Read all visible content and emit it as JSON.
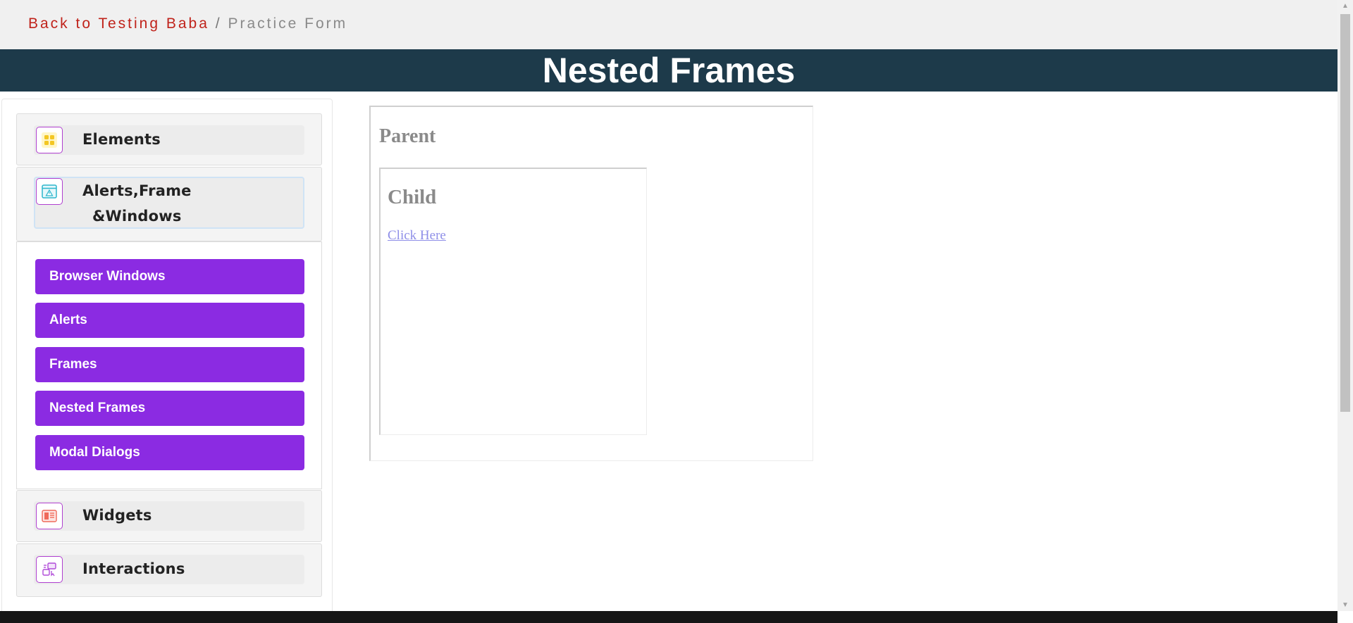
{
  "breadcrumb": {
    "link": "Back to Testing Baba",
    "separator": "/",
    "current": "Practice Form"
  },
  "page_title": "Nested Frames",
  "sidebar": {
    "groups": [
      {
        "label": "Elements",
        "icon": "grid-icon"
      },
      {
        "label_line1": "Alerts,Frame",
        "label_line2": "&Windows",
        "icon": "window-alert-icon",
        "active": true
      },
      {
        "label": "Widgets",
        "icon": "widgets-icon"
      },
      {
        "label": "Interactions",
        "icon": "interactions-icon"
      }
    ],
    "submenu": [
      "Browser Windows",
      "Alerts",
      "Frames",
      "Nested Frames",
      "Modal Dialogs"
    ]
  },
  "frames": {
    "parent_title": "Parent",
    "child_title": "Child",
    "child_link": "Click Here"
  },
  "colors": {
    "banner": "#1d3a4a",
    "menu_button": "#8b2be2",
    "breadcrumb_link": "#c0231b"
  }
}
